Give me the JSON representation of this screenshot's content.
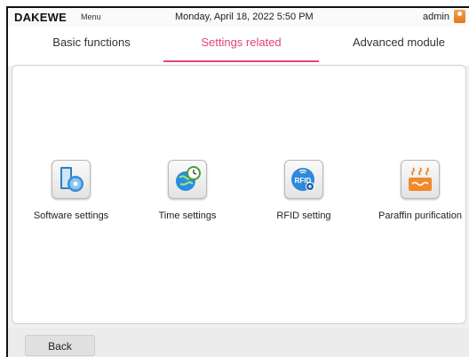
{
  "header": {
    "logo": "DAKEWE",
    "menu_label": "Menu",
    "datetime": "Monday, April 18, 2022 5:50 PM",
    "user": "admin"
  },
  "tabs": [
    {
      "label": "Basic functions",
      "active": false
    },
    {
      "label": "Settings related",
      "active": true
    },
    {
      "label": "Advanced module",
      "active": false
    }
  ],
  "items": [
    {
      "label": "Software settings",
      "icon": "software-settings-icon"
    },
    {
      "label": "Time settings",
      "icon": "time-settings-icon"
    },
    {
      "label": "RFID setting",
      "icon": "rfid-icon",
      "icon_text": "RFID"
    },
    {
      "label": "Paraffin purification",
      "icon": "paraffin-purification-icon"
    }
  ],
  "footer": {
    "back_label": "Back"
  },
  "colors": {
    "accent": "#e4427d",
    "background": "#f1f1f1",
    "panel": "#ffffff"
  }
}
